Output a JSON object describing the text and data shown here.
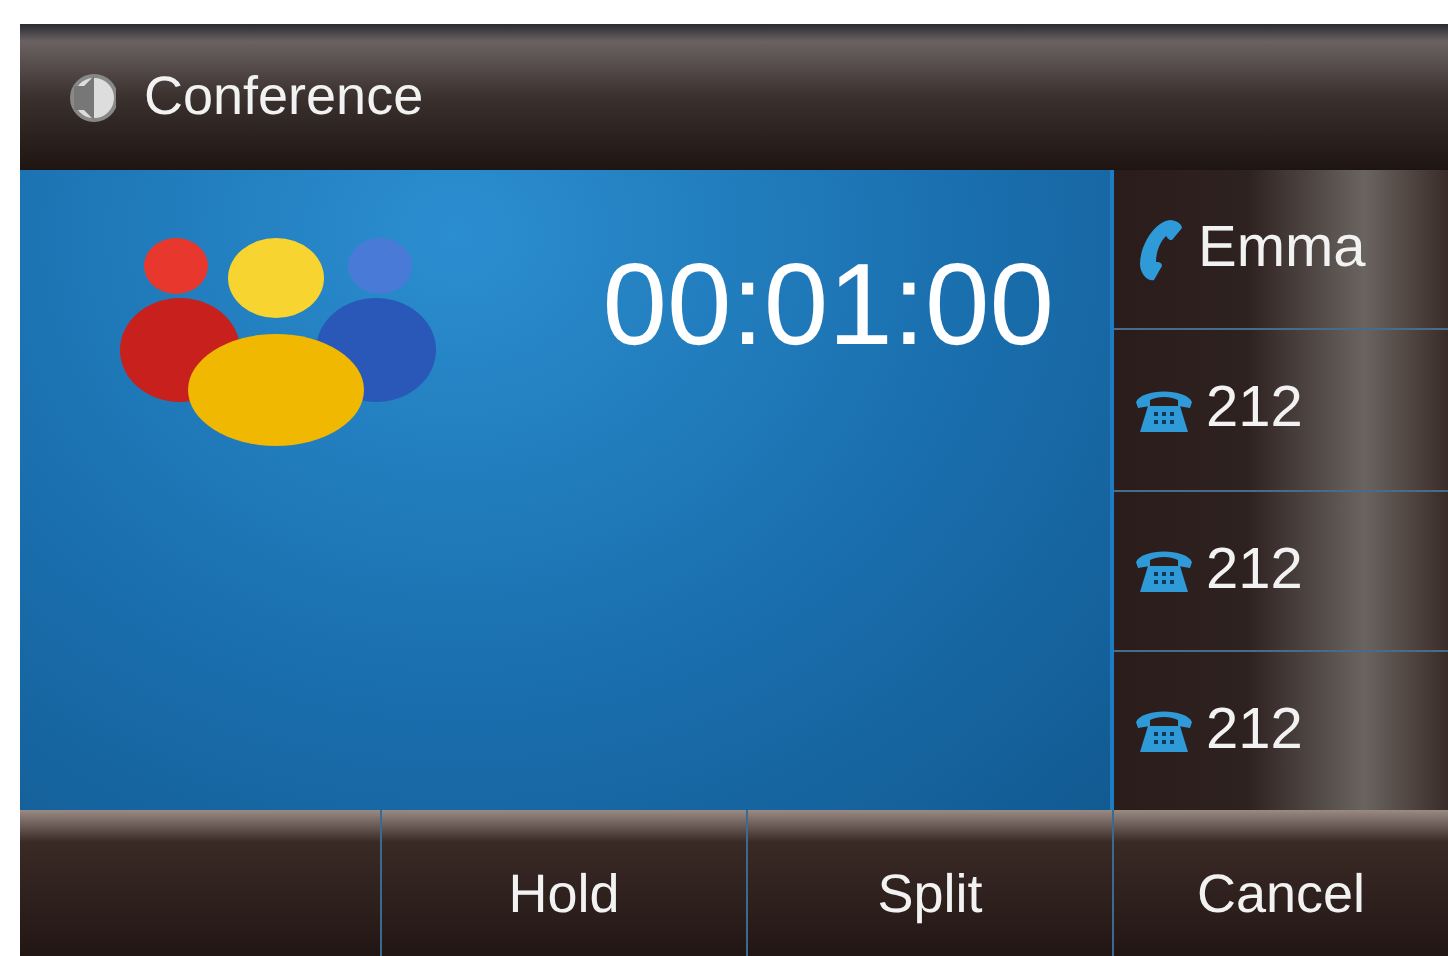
{
  "title": "Conference",
  "timer": "00:01:00",
  "calls": [
    {
      "kind": "handset",
      "label": "Emma"
    },
    {
      "kind": "desk-phone",
      "label": "212"
    },
    {
      "kind": "desk-phone",
      "label": "212"
    },
    {
      "kind": "desk-phone",
      "label": "212"
    }
  ],
  "softkeys": [
    "Hold",
    "Split",
    "Cancel"
  ]
}
